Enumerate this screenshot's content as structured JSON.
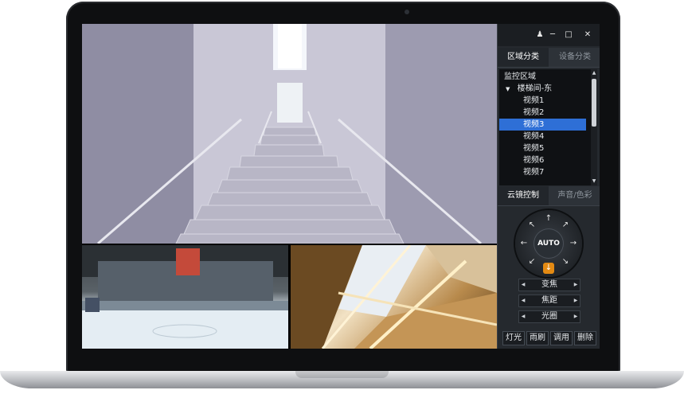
{
  "panel": {
    "tabs_top": [
      {
        "label": "区域分类",
        "active": true
      },
      {
        "label": "设备分类",
        "active": false
      }
    ],
    "tree": {
      "root": "监控区域",
      "group": "楼梯间-东",
      "items": [
        "视频1",
        "视频2",
        "视频3",
        "视频4",
        "视频5",
        "视频6",
        "视频7"
      ],
      "selected_index": 2
    },
    "tabs_mid": [
      {
        "label": "云镜控制",
        "active": true
      },
      {
        "label": "声音/色彩",
        "active": false
      }
    ],
    "ptz": {
      "center_label": "AUTO"
    },
    "adjust": [
      {
        "label": "变焦"
      },
      {
        "label": "焦距"
      },
      {
        "label": "光圈"
      }
    ],
    "buttons": [
      "灯光",
      "雨刷",
      "调用",
      "删除"
    ]
  },
  "colors": {
    "panel_bg": "#25292e",
    "selection": "#2e6fd6",
    "ptz_active": "#e38a13"
  }
}
